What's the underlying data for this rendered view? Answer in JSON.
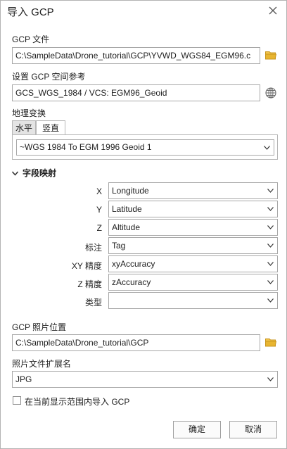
{
  "dialog": {
    "title": "导入 GCP"
  },
  "gcp_file": {
    "label": "GCP 文件",
    "value": "C:\\SampleData\\Drone_tutorial\\GCP\\YVWD_WGS84_EGM96.c"
  },
  "spatial_ref": {
    "label": "设置 GCP 空间参考",
    "value": "GCS_WGS_1984 / VCS: EGM96_Geoid"
  },
  "geo_transform": {
    "label": "地理变换",
    "tabs": [
      {
        "label": "水平"
      },
      {
        "label": "竖直"
      }
    ],
    "active_tab": "竖直",
    "value": "~WGS 1984 To EGM 1996 Geoid 1"
  },
  "field_mapping": {
    "section_label": "字段映射",
    "expanded": true,
    "rows": [
      {
        "label": "X",
        "value": "Longitude"
      },
      {
        "label": "Y",
        "value": "Latitude"
      },
      {
        "label": "Z",
        "value": "Altitude"
      },
      {
        "label": "标注",
        "value": "Tag"
      },
      {
        "label": "XY 精度",
        "value": "xyAccuracy"
      },
      {
        "label": "Z 精度",
        "value": "zAccuracy"
      },
      {
        "label": "类型",
        "value": ""
      }
    ]
  },
  "photo_location": {
    "label": "GCP 照片位置",
    "value": "C:\\SampleData\\Drone_tutorial\\GCP"
  },
  "photo_ext": {
    "label": "照片文件扩展名",
    "value": "JPG"
  },
  "import_extent": {
    "label": "在当前显示范围内导入 GCP",
    "checked": false
  },
  "buttons": {
    "ok": "确定",
    "cancel": "取消"
  },
  "colors": {
    "folder": "#e8b530",
    "globe": "#6b6b6b",
    "border": "#a8a8a8"
  }
}
